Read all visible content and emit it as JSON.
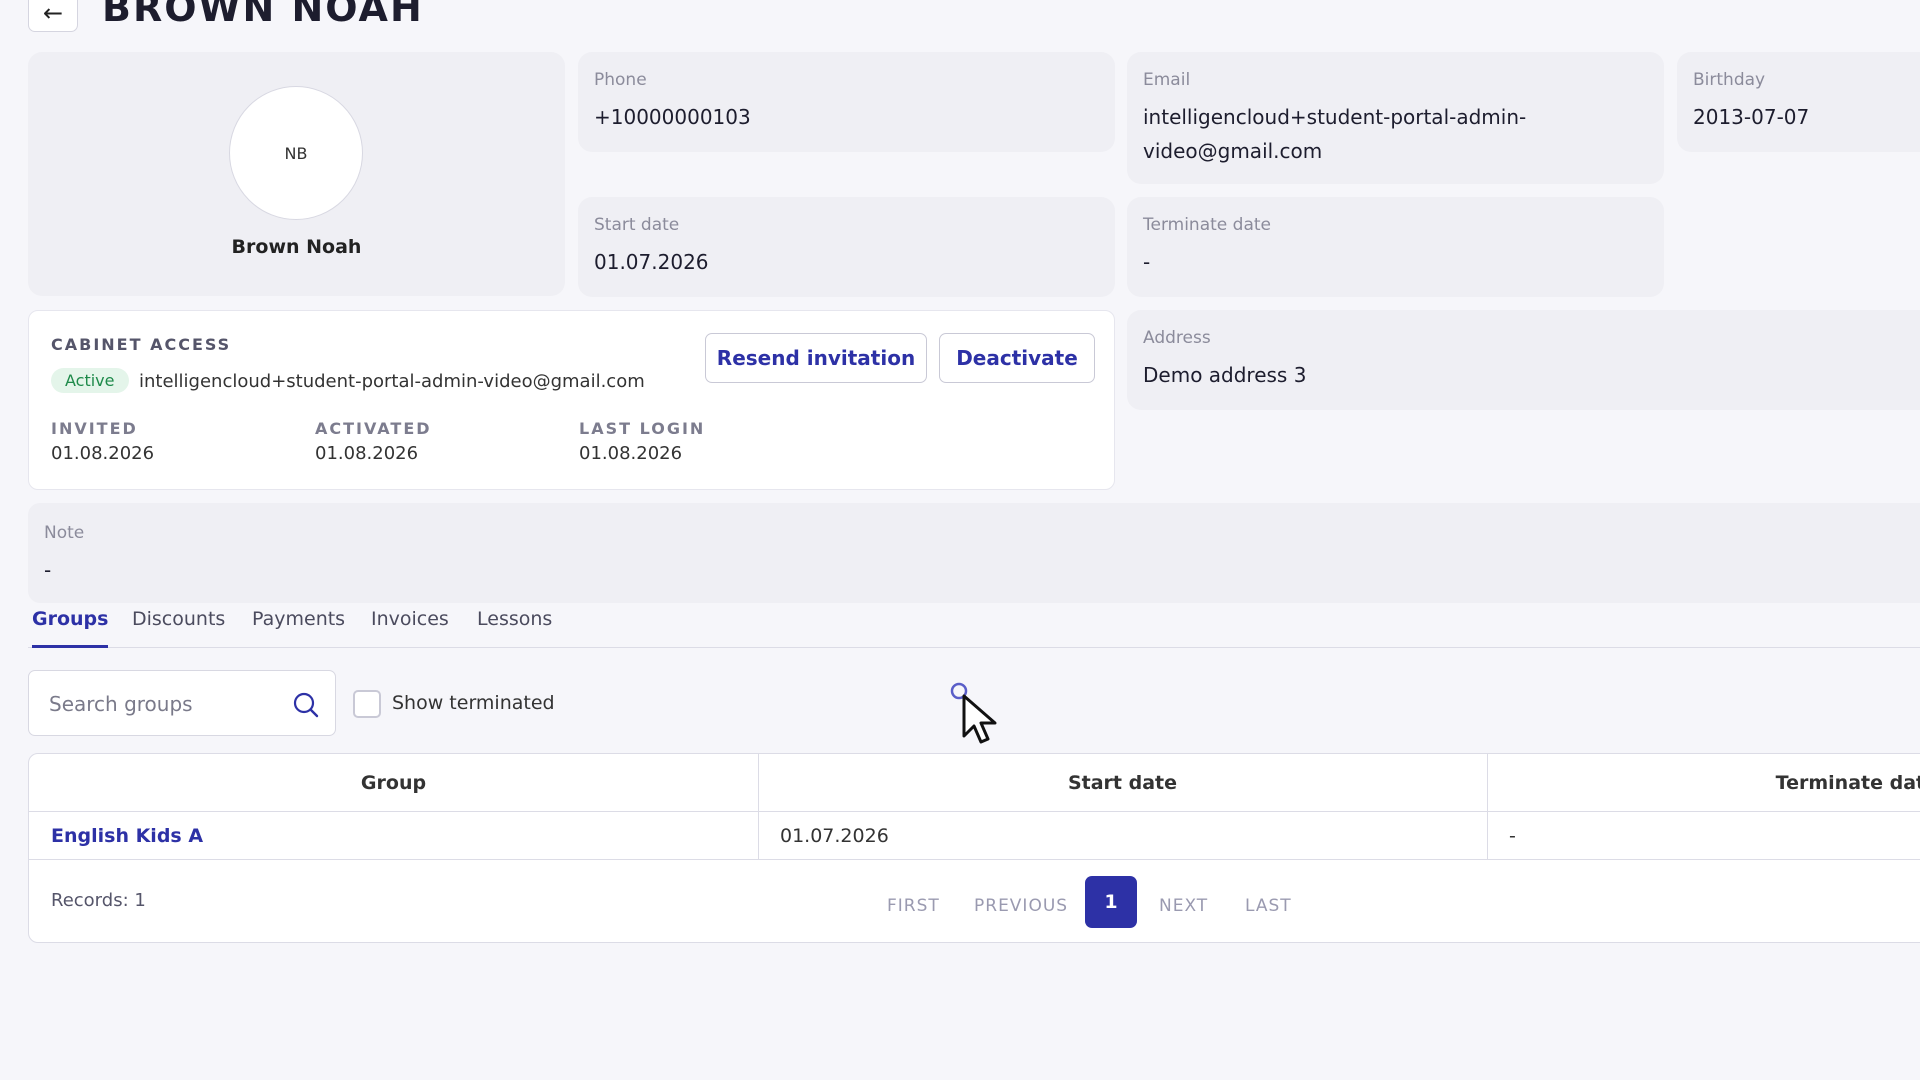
{
  "header": {
    "back_icon": "←",
    "title": "BROWN NOAH"
  },
  "profile": {
    "initials": "NB",
    "name": "Brown Noah"
  },
  "fields": {
    "phone": {
      "label": "Phone",
      "value": "+10000000103"
    },
    "email": {
      "label": "Email",
      "value_line1": "intelligencloud+student-portal-admin-",
      "value_line2": "video@gmail.com"
    },
    "birthday": {
      "label": "Birthday",
      "value": "2013-07-07"
    },
    "start_date": {
      "label": "Start date",
      "value": "01.07.2026"
    },
    "terminate_date": {
      "label": "Terminate date",
      "value": "-"
    },
    "address": {
      "label": "Address",
      "value": "Demo address 3"
    },
    "note": {
      "label": "Note",
      "value": "-"
    }
  },
  "cabinet": {
    "title": "CABINET ACCESS",
    "status": "Active",
    "email": "intelligencloud+student-portal-admin-video@gmail.com",
    "resend_label": "Resend invitation",
    "deactivate_label": "Deactivate",
    "invited_label": "INVITED",
    "invited_value": "01.08.2026",
    "activated_label": "ACTIVATED",
    "activated_value": "01.08.2026",
    "last_login_label": "LAST LOGIN",
    "last_login_value": "01.08.2026"
  },
  "tabs": [
    {
      "label": "Groups",
      "active": true
    },
    {
      "label": "Discounts"
    },
    {
      "label": "Payments"
    },
    {
      "label": "Invoices"
    },
    {
      "label": "Lessons"
    }
  ],
  "filters": {
    "search_placeholder": "Search groups",
    "show_terminated_label": "Show terminated",
    "show_terminated_checked": false
  },
  "table": {
    "columns": [
      "Group",
      "Start date",
      "Terminate date"
    ],
    "rows": [
      {
        "group": "English Kids A",
        "start_date": "01.07.2026",
        "terminate_date": "-"
      }
    ],
    "records_label": "Records: 1"
  },
  "pagination": {
    "first": "FIRST",
    "previous": "PREVIOUS",
    "current": "1",
    "next": "NEXT",
    "last": "LAST"
  },
  "colors": {
    "accent": "#2d31a6",
    "active_status_bg": "#e4f5ea",
    "active_status_text": "#1e8a4a"
  }
}
